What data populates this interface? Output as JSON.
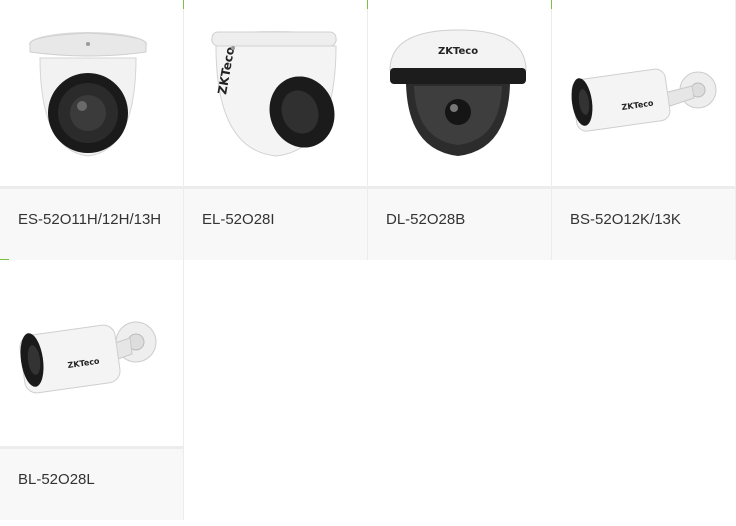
{
  "products": [
    {
      "name": "ES-52O11H/12H/13H",
      "image": "dome-camera-image"
    },
    {
      "name": "EL-52O28I",
      "image": "eyeball-camera-image"
    },
    {
      "name": "DL-52O28B",
      "image": "dome-camera-image"
    },
    {
      "name": "BS-52O12K/13K",
      "image": "bullet-camera-image"
    },
    {
      "name": "BL-52O28L",
      "image": "bullet-camera-image"
    }
  ],
  "brand": {
    "logo_text": "ZKTeco"
  },
  "colors": {
    "accent": "#7ac143",
    "label_bg": "#f8f8f8",
    "border": "#ececec",
    "text": "#333333"
  }
}
